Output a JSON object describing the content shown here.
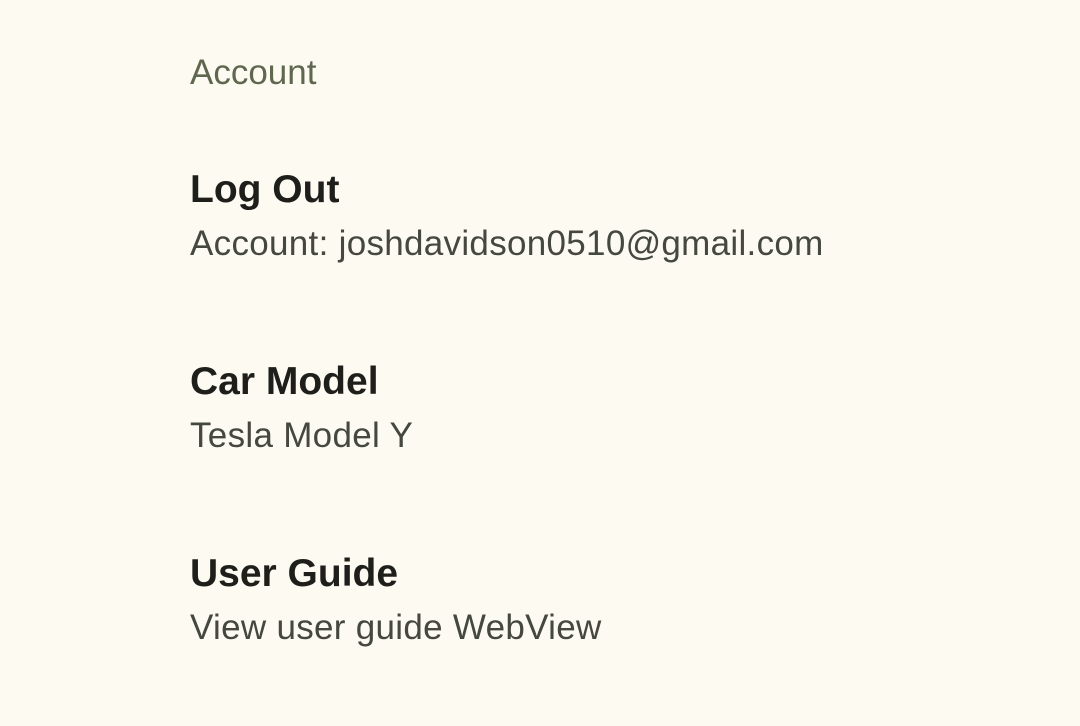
{
  "section": {
    "title": "Account"
  },
  "preferences": [
    {
      "title": "Log Out",
      "summary": "Account: joshdavidson0510@gmail.com"
    },
    {
      "title": "Car Model",
      "summary": "Tesla Model Y"
    },
    {
      "title": "User Guide",
      "summary": "View user guide WebView"
    }
  ],
  "colors": {
    "background": "#fdfaf2",
    "section_header": "#5f684f",
    "title_text": "#1e1e1a",
    "summary_text": "#45483f"
  }
}
